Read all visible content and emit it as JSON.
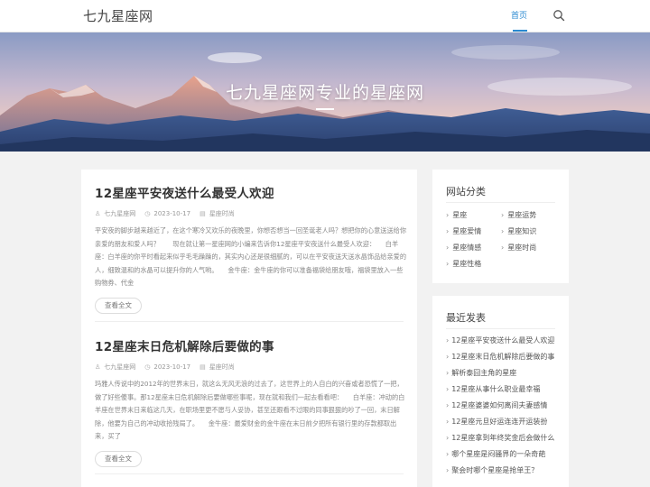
{
  "header": {
    "logo": "七九星座网",
    "nav_home": "首页",
    "search_icon": "search-icon"
  },
  "banner": {
    "title": "七九星座网专业的星座网"
  },
  "posts": [
    {
      "title": "12星座平安夜送什么最受人欢迎",
      "author": "七九星座网",
      "date": "2023-10-17",
      "category": "星座时尚",
      "excerpt": "平安夜的脚步越来越近了，在这个寒冷又欢乐的夜晚里，你想否想当一回圣诞老人吗？想把你的心意送送给你亲爱的朋友和爱人吗？　　现在就让第一星座网的小编来告诉你12星座平安夜送什么最受人欢迎：　　白羊座：白羊座的你平时看起来似乎毛毛躁躁的，其实内心还是很细腻的，可以在平安夜送天送水晶饰品给亲爱的人，细致温和的水晶可以提升你的人气哟。　　金牛座：金牛座的你可以准备福袋给朋友哦，福袋里放入一些购物券、代金",
      "more": "查看全文"
    },
    {
      "title": "12星座末日危机解除后要做的事",
      "author": "七九星座网",
      "date": "2023-10-17",
      "category": "星座时尚",
      "excerpt": "玛雅人传说中的2012年的世界末日，就这么无风无浪的过去了，这世界上的人自白的兴奋或者恐慌了一把，做了好些傻事。那12星座末日危机解除后要做哪些事呢，现在就和我们一起去看看吧：　　白羊座：冲动的白羊座在世界末日来临这几天，在职场里更不愿与人妥协，甚至还跟看不过眼的同事狠狠的吵了一回，末日解除，他要为自己的冲动收拾残局了。　　金牛座：最爱财金的金牛座在末日前夕把所有银行里的存款都取出来，买了",
      "more": "查看全文"
    }
  ],
  "sidebar": {
    "categories_title": "网站分类",
    "categories": [
      "星座",
      "星座运势",
      "星座爱情",
      "星座知识",
      "星座情感",
      "星座时尚",
      "星座性格"
    ],
    "recent_title": "最近发表",
    "recent": [
      "12星座平安夜送什么最受人欢迎",
      "12星座末日危机解除后要做的事",
      "解析泰囧主角的星座",
      "12星座从事什么职业最幸福",
      "12星座婆婆如何离间夫妻感情",
      "12星座元旦好运连连开运装扮",
      "12星座拿到年终奖金后会做什么",
      "哪个星座是闷骚界的一朵奇葩",
      "聚会时哪个星座是抢单王？"
    ]
  },
  "colors": {
    "accent": "#2a8ad1",
    "background": "#f2f2f2"
  }
}
